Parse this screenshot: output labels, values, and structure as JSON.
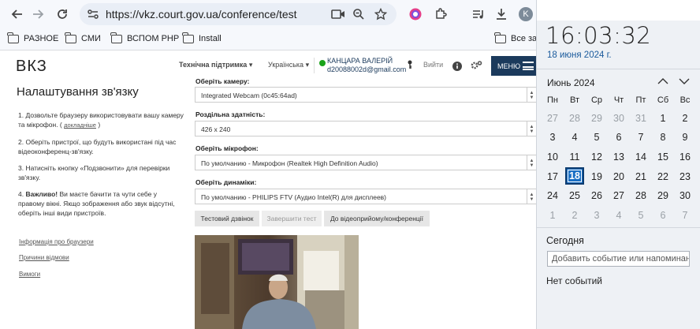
{
  "browser": {
    "url": "https://vkz.court.gov.ua/conference/test",
    "profile_initial": "K",
    "bookmarks": [
      "РАЗНОЕ",
      "СМИ",
      "ВСПОМ РНР",
      "Install",
      "Все зак"
    ]
  },
  "site": {
    "logo": "ВКЗ",
    "support": "Технічна підтримка",
    "language": "Українська",
    "user_name": "КАНЦАРА ВАЛЕРІЙ",
    "user_email": "d20088002d@gmail.com",
    "logout": "Вийти",
    "menu": "МЕНЮ",
    "status_color": "#1aa31a",
    "menu_color": "#1b3a5c"
  },
  "setup": {
    "title": "Налаштування зв'язку",
    "steps": [
      {
        "num": "1.",
        "text": "Дозвольте браузеру використовувати вашу камеру та мікрофон. (",
        "link": "докладніше",
        "tail": ")"
      },
      {
        "num": "2.",
        "text": "Оберіть пристрої, що будуть використані під час відеоконференц-зв'язку."
      },
      {
        "num": "3.",
        "text": "Натисніть кнопку «Подзвонити» для перевірки зв'язку."
      },
      {
        "num": "4.",
        "bold": "Важливо!",
        "text": " Ви маєте бачити та чути себе у правому вікні. Якщо зображення або звук відсутні, оберіть інші види пристроїв."
      }
    ],
    "links": [
      "Інформація про браузери",
      "Причини відмови",
      "Вимоги"
    ]
  },
  "form": {
    "camera_label": "Оберіть камеру:",
    "camera_value": "Integrated Webcam (0c45:64ad)",
    "resolution_label": "Роздільна здатність:",
    "resolution_value": "426 x 240",
    "mic_label": "Оберіть мікрофон:",
    "mic_value": "По умолчанию - Микрофон (Realtek High Definition Audio)",
    "speaker_label": "Оберіть динаміки:",
    "speaker_value": "По умолчанию - PHILIPS FTV (Аудио Intel(R) для дисплеев)",
    "buttons": [
      "Тестовий дзвінок",
      "Завершити тест",
      "До відеоприйому/конференції"
    ]
  },
  "calendar": {
    "time": "16:03:32",
    "date": "18 июня 2024 г.",
    "month": "Июнь 2024",
    "weekdays": [
      "Пн",
      "Вт",
      "Ср",
      "Чт",
      "Пт",
      "Сб",
      "Вс"
    ],
    "weeks": [
      [
        "27",
        "28",
        "29",
        "30",
        "31",
        "1",
        "2"
      ],
      [
        "3",
        "4",
        "5",
        "6",
        "7",
        "8",
        "9"
      ],
      [
        "10",
        "11",
        "12",
        "13",
        "14",
        "15",
        "16"
      ],
      [
        "17",
        "18",
        "19",
        "20",
        "21",
        "22",
        "23"
      ],
      [
        "24",
        "25",
        "26",
        "27",
        "28",
        "29",
        "30"
      ],
      [
        "1",
        "2",
        "3",
        "4",
        "5",
        "6",
        "7"
      ]
    ],
    "today": "18",
    "today_label": "Сегодня",
    "event_placeholder": "Добавить событие или напоминан",
    "no_events": "Нет событий",
    "accent": "#1a6fc4"
  }
}
